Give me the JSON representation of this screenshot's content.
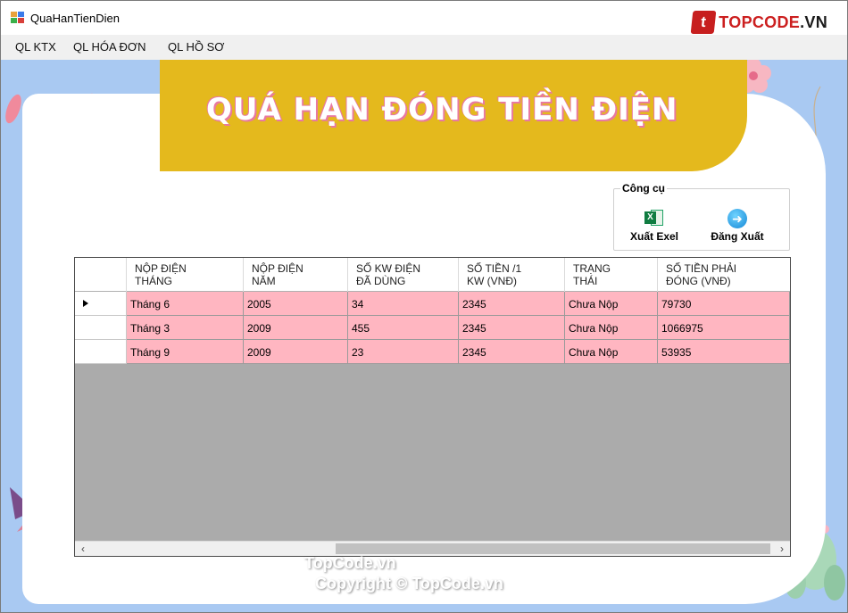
{
  "window": {
    "title": "QuaHanTienDien",
    "brand": {
      "text_main": "TOPCODE",
      "text_suffix": ".VN",
      "badge": "t"
    }
  },
  "menu": [
    {
      "label": "QL KTX"
    },
    {
      "label": "QL HÓA ĐƠN"
    },
    {
      "label": "QL HỒ SƠ"
    }
  ],
  "banner": {
    "title": "QUÁ HẠN ĐÓNG TIỀN ĐIỆN"
  },
  "tools": {
    "legend": "Công cụ",
    "export_label": "Xuất Exel",
    "logout_label": "Đăng Xuất"
  },
  "grid": {
    "columns": [
      {
        "line1": "NỘP ĐIỆN",
        "line2": "THÁNG"
      },
      {
        "line1": "NỘP ĐIỆN",
        "line2": "NĂM"
      },
      {
        "line1": "SỐ KW ĐIỆN",
        "line2": "ĐÃ DÙNG"
      },
      {
        "line1": "SỐ TIỀN /1",
        "line2": "KW (VNĐ)"
      },
      {
        "line1": "TRẠNG",
        "line2": "THÁI"
      },
      {
        "line1": "SỐ TIỀN PHẢI",
        "line2": "ĐÓNG (VNĐ)"
      }
    ],
    "rows": [
      [
        "Tháng 6",
        "2005",
        "34",
        "2345",
        "Chưa Nộp",
        "79730"
      ],
      [
        "Tháng 3",
        "2009",
        "455",
        "2345",
        "Chưa Nộp",
        "1066975"
      ],
      [
        "Tháng 9",
        "2009",
        "23",
        "2345",
        "Chưa Nộp",
        "53935"
      ]
    ],
    "current_row": 0
  },
  "watermark": {
    "line1": "TopCode.vn",
    "line2": "Copyright © TopCode.vn"
  },
  "colors": {
    "banner": "#e4b91d",
    "row_fill": "#ffb6c1",
    "background": "#a9c9f2",
    "brand_red": "#cc1f1f"
  }
}
